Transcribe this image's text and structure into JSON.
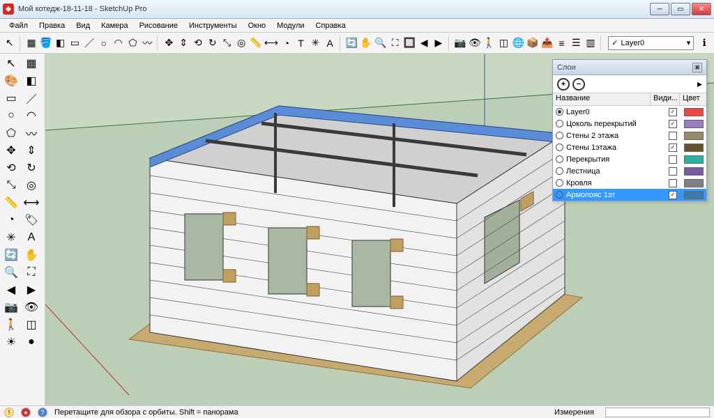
{
  "window": {
    "title": "Мой котедж-18-11-18 - SketchUp Pro"
  },
  "menu": {
    "items": [
      "Файл",
      "Правка",
      "Вид",
      "Камера",
      "Рисование",
      "Инструменты",
      "Окно",
      "Модули",
      "Справка"
    ]
  },
  "toolbar_top": {
    "layer_select": {
      "label": "Layer0"
    },
    "icons": [
      "select-icon",
      "make-component-icon",
      "paint-bucket-icon",
      "eraser-icon",
      "rectangle-icon",
      "line-icon",
      "circle-icon",
      "arc-icon",
      "polygon-icon",
      "freehand-icon",
      "move-icon",
      "push-pull-icon",
      "rotate-icon",
      "follow-me-icon",
      "scale-icon",
      "offset-icon",
      "tape-measure-icon",
      "dimension-icon",
      "protractor-icon",
      "text-icon",
      "axes-icon",
      "3d-text-icon",
      "orbit-icon",
      "pan-icon",
      "zoom-icon",
      "zoom-extents-icon",
      "zoom-window-icon",
      "previous-view-icon",
      "next-view-icon",
      "position-camera-icon",
      "look-around-icon",
      "walk-icon",
      "section-plane-icon",
      "google-earth-icon",
      "get-models-icon",
      "share-model-icon",
      "outliner-icon",
      "layers-icon",
      "windows-icon"
    ]
  },
  "toolbar_left": {
    "rows": [
      [
        "select-icon",
        "component-icon"
      ],
      [
        "paint-bag-icon",
        "eraser-icon"
      ],
      [
        "rectangle-icon",
        "line-icon"
      ],
      [
        "circle-icon",
        "arc-icon"
      ],
      [
        "polygon-icon",
        "freehand-icon"
      ],
      [
        "move-shapes-icon",
        "push-pull-green-icon"
      ],
      [
        "rotate-red-icon",
        "follow-me-green-icon"
      ],
      [
        "scale-icon",
        "offset-icon"
      ],
      [
        "tape-icon",
        "dimension-icon"
      ],
      [
        "protractor-icon",
        "text-label-icon"
      ],
      [
        "axes-icon",
        "3d-text-icon"
      ],
      [
        "orbit-icon",
        "pan-icon"
      ],
      [
        "zoom-icon",
        "zoom-extents-icon"
      ],
      [
        "prev-icon",
        "next-icon"
      ],
      [
        "camera-pos-icon",
        "look-icon"
      ],
      [
        "walk-icon",
        "section-icon"
      ],
      [
        "sun-icon",
        "shadow-icon"
      ]
    ]
  },
  "layers_panel": {
    "title": "Слои",
    "header": {
      "name": "Название",
      "visible": "Види...",
      "color": "Цвет"
    },
    "add_tooltip": "Добавить",
    "del_tooltip": "Удалить",
    "rows": [
      {
        "name": "Layer0",
        "active": true,
        "visible": true,
        "color": "#e84a4a",
        "selected": false
      },
      {
        "name": "Цоколь перекрытий",
        "active": false,
        "visible": true,
        "color": "#9a7ac0",
        "selected": false
      },
      {
        "name": "Стены 2 этажа",
        "active": false,
        "visible": false,
        "color": "#9a8a6a",
        "selected": false
      },
      {
        "name": "Стены 1этажа",
        "active": false,
        "visible": true,
        "color": "#6a5028",
        "selected": false
      },
      {
        "name": "Перекрытия",
        "active": false,
        "visible": false,
        "color": "#2cb0a0",
        "selected": false
      },
      {
        "name": "Лестница",
        "active": false,
        "visible": false,
        "color": "#7a5aa0",
        "selected": false
      },
      {
        "name": "Кровля",
        "active": false,
        "visible": false,
        "color": "#808080",
        "selected": false
      },
      {
        "name": "Армопояс 1эт",
        "active": false,
        "visible": true,
        "color": "#3a7ab0",
        "selected": true
      }
    ]
  },
  "statusbar": {
    "hint": "Перетащите для обзора с орбиты.  Shift = панорама",
    "measure_label": "Измерения"
  }
}
